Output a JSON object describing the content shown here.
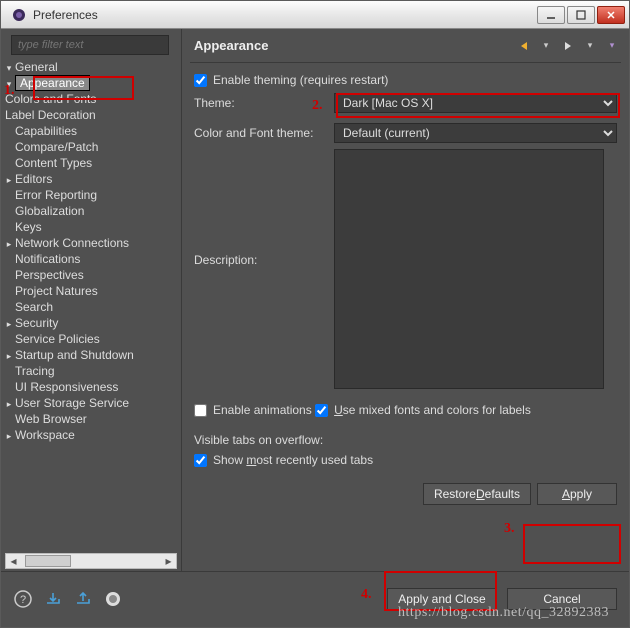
{
  "window": {
    "title": "Preferences"
  },
  "filter": {
    "placeholder": "type filter text"
  },
  "tree": {
    "top": "General",
    "selected": "Appearance",
    "sub": [
      "Colors and Fonts",
      "Label Decoration"
    ],
    "items": [
      "Capabilities",
      "Compare/Patch",
      "Content Types",
      "Editors",
      "Error Reporting",
      "Globalization",
      "Keys",
      "Network Connections",
      "Notifications",
      "Perspectives",
      "Project Natures",
      "Search",
      "Security",
      "Service Policies",
      "Startup and Shutdown",
      "Tracing",
      "UI Responsiveness",
      "User Storage Service",
      "Web Browser",
      "Workspace"
    ]
  },
  "page": {
    "title": "Appearance",
    "enableTheming": {
      "label": "Enable theming (requires restart)",
      "checked": true
    },
    "themeLabel": "Theme:",
    "themeValue": "Dark [Mac OS X]",
    "colorFontLabel": "Color and Font theme:",
    "colorFontValue": "Default (current)",
    "descriptionLabel": "Description:",
    "enableAnimations": {
      "label": "Enable animations",
      "checked": false
    },
    "useMixedFonts": {
      "label": "Use mixed fonts and colors for labels",
      "checked": true
    },
    "visibleTabsLabel": "Visible tabs on overflow:",
    "showMRU": {
      "label": "Show most recently used tabs",
      "checked": true
    },
    "restoreDefaults": "Restore Defaults",
    "apply": "Apply"
  },
  "bottom": {
    "applyClose": "Apply and Close",
    "cancel": "Cancel"
  },
  "annotations": {
    "n1": "1.",
    "n2": "2.",
    "n3": "3.",
    "n4": "4."
  },
  "watermark": "https://blog.csdn.net/qq_32892383"
}
